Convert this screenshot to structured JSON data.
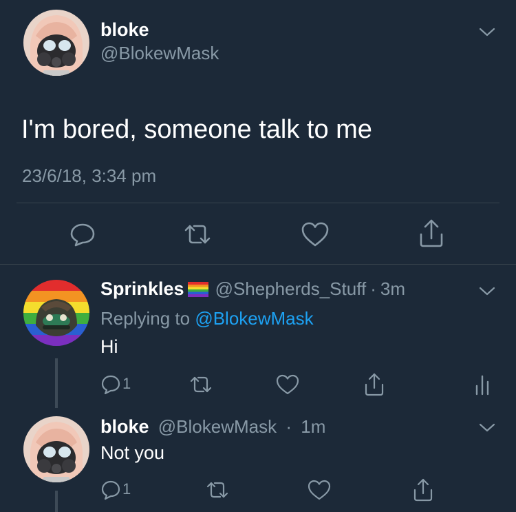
{
  "main_tweet": {
    "display_name": "bloke",
    "handle": "@BlokewMask",
    "text": "I'm bored, someone talk to me",
    "timestamp": "23/6/18, 3:34 pm"
  },
  "reply1": {
    "display_name": "Sprinkles",
    "handle": "@Shepherds_Stuff",
    "separator": "·",
    "time": "3m",
    "replying_prefix": "Replying to",
    "replying_to": "@BlokewMask",
    "text": "Hi",
    "reply_count": "1"
  },
  "reply2": {
    "display_name": "bloke",
    "handle": "@BlokewMask",
    "separator": "·",
    "time": "1m",
    "text": "Not you",
    "reply_count": "1"
  },
  "colors": {
    "background": "#1c2938",
    "text": "#ffffff",
    "muted": "#8899a6",
    "link": "#1da1f2",
    "divider": "#38444d"
  },
  "icons": {
    "reply": "speech-bubble-icon",
    "retweet": "retweet-arrows-icon",
    "like": "heart-icon",
    "share": "share-upload-icon",
    "analytics": "bar-chart-icon",
    "menu": "chevron-down-icon",
    "flag": "rainbow-flag-emoji"
  }
}
